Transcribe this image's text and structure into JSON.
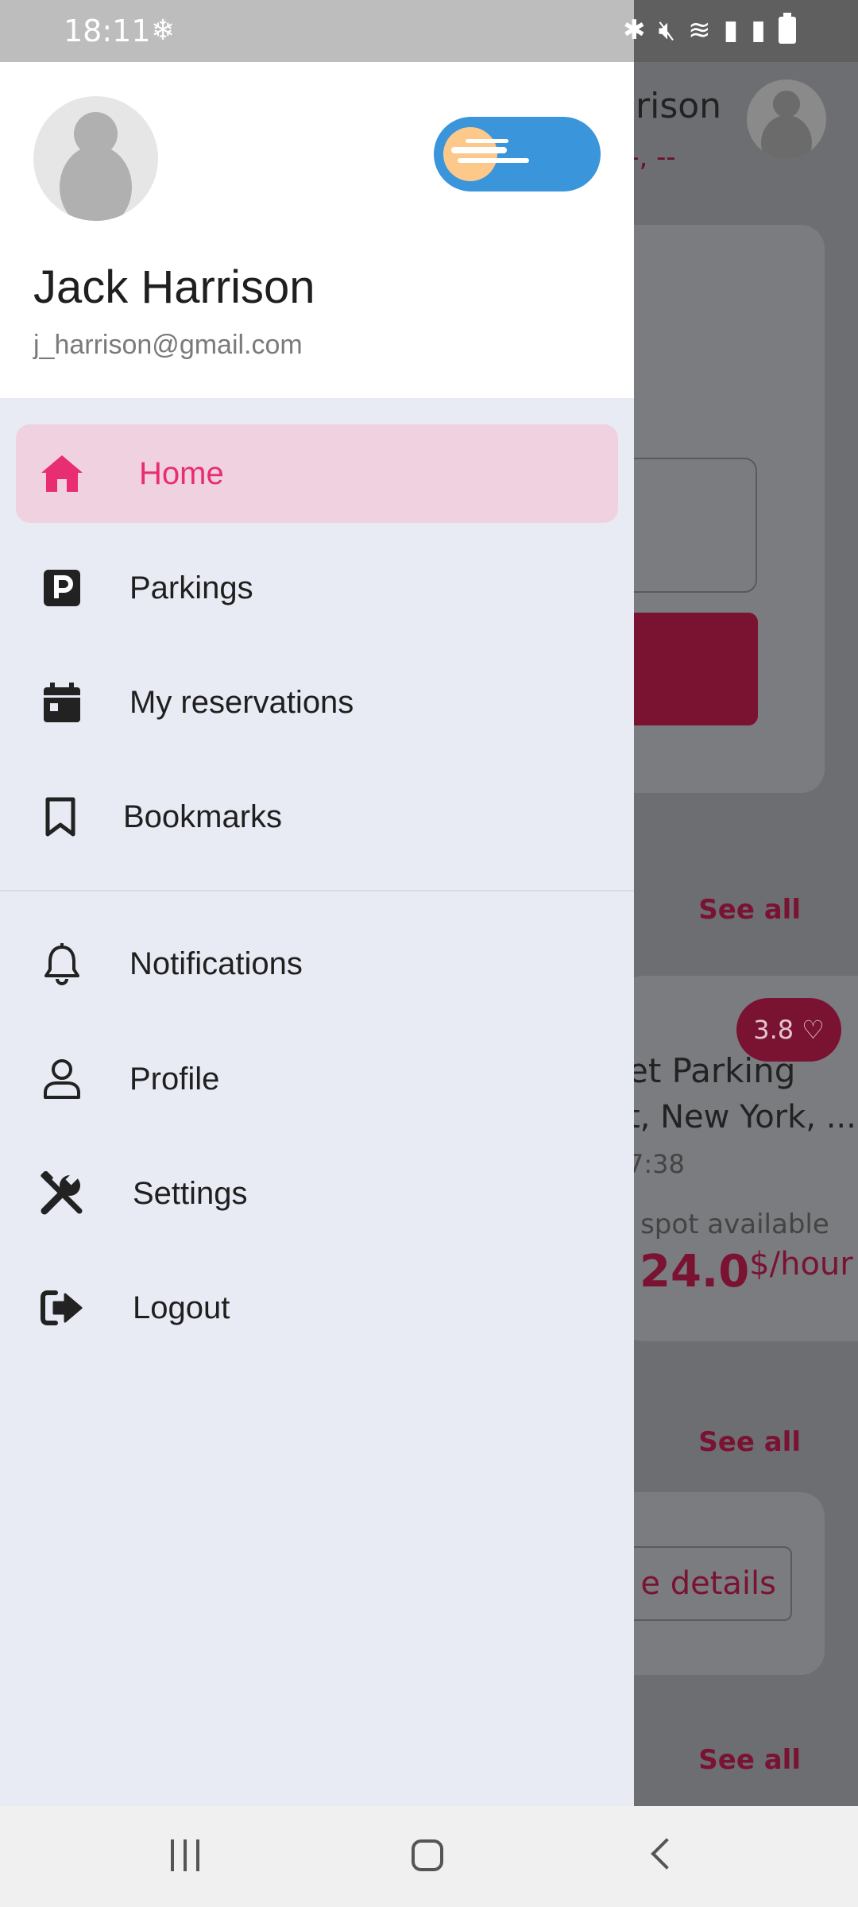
{
  "status_bar": {
    "time": "18:11",
    "fan_icon": "fan-icon",
    "icons": [
      "bluetooth-icon",
      "mute-icon",
      "wifi-icon",
      "signal-icon",
      "signal-icon",
      "battery-icon"
    ]
  },
  "background": {
    "name_partial": "rison",
    "dash_text": "--, --",
    "see_all": "See all",
    "rating": "3.8",
    "parking_title": "et Parking",
    "parking_address": "t, New York, ...",
    "parking_time": "7:38",
    "spot": ") spot available",
    "price": "24.0",
    "price_unit": "$/hour",
    "details_button": "e details"
  },
  "drawer": {
    "user": {
      "name": "Jack Harrison",
      "email": "j_harrison@gmail.com"
    },
    "theme_toggle": "light",
    "menu": [
      {
        "label": "Home",
        "icon": "home-icon",
        "active": true
      },
      {
        "label": "Parkings",
        "icon": "parking-icon"
      },
      {
        "label": "My reservations",
        "icon": "calendar-icon"
      },
      {
        "label": "Bookmarks",
        "icon": "bookmark-icon"
      },
      {
        "label": "Notifications",
        "icon": "bell-icon"
      },
      {
        "label": "Profile",
        "icon": "user-icon"
      },
      {
        "label": "Settings",
        "icon": "tools-icon"
      },
      {
        "label": "Logout",
        "icon": "logout-icon"
      }
    ]
  },
  "colors": {
    "accent": "#e92d72",
    "active_bg": "#efd1df",
    "drawer_bg": "#e8ebf3",
    "toggle": "#3a95db"
  }
}
